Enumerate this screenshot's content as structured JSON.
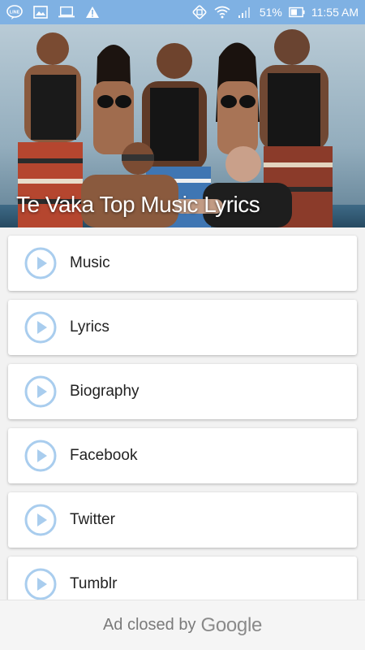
{
  "status_bar": {
    "battery_percent": "51%",
    "time": "11:55 AM",
    "icons": [
      "line-icon",
      "image-icon",
      "laptop-icon",
      "warning-icon",
      "sync-icon",
      "wifi-icon",
      "signal-icon",
      "battery-icon"
    ],
    "color": "#7fb1e3"
  },
  "header": {
    "title": "Te Vaka Top Music Lyrics"
  },
  "menu": {
    "items": [
      {
        "label": "Music",
        "icon": "play-circle-icon"
      },
      {
        "label": "Lyrics",
        "icon": "play-circle-icon"
      },
      {
        "label": "Biography",
        "icon": "play-circle-icon"
      },
      {
        "label": "Facebook",
        "icon": "play-circle-icon"
      },
      {
        "label": "Twitter",
        "icon": "play-circle-icon"
      },
      {
        "label": "Tumblr",
        "icon": "play-circle-icon"
      }
    ],
    "icon_color": "#a9cdee"
  },
  "ad": {
    "text": "Ad closed by",
    "brand": "Google"
  }
}
